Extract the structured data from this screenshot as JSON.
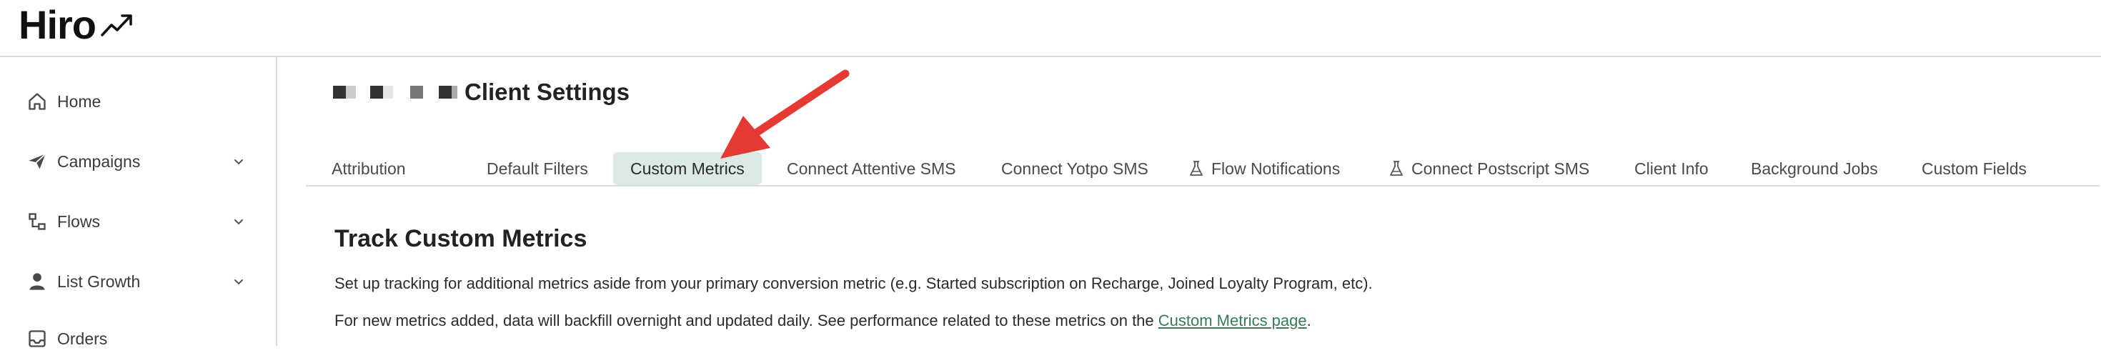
{
  "app": {
    "logo_text": "Hiro",
    "logo_icon": "trending-up-icon"
  },
  "sidebar": {
    "items": [
      {
        "label": "Home",
        "icon": "home-icon",
        "has_chevron": false
      },
      {
        "label": "Campaigns",
        "icon": "paper-plane-icon",
        "has_chevron": true
      },
      {
        "label": "Flows",
        "icon": "flow-icon",
        "has_chevron": true
      },
      {
        "label": "List Growth",
        "icon": "user-icon",
        "has_chevron": true
      },
      {
        "label": "Orders",
        "icon": "orders-icon",
        "has_chevron": false
      }
    ]
  },
  "header": {
    "title": "Client Settings"
  },
  "tabs": [
    {
      "label": "Attribution",
      "active": false,
      "icon": ""
    },
    {
      "label": "Default Filters",
      "active": false,
      "icon": ""
    },
    {
      "label": "Custom Metrics",
      "active": true,
      "icon": ""
    },
    {
      "label": "Connect Attentive SMS",
      "active": false,
      "icon": ""
    },
    {
      "label": "Connect Yotpo SMS",
      "active": false,
      "icon": ""
    },
    {
      "label": "Flow Notifications",
      "active": false,
      "icon": "flask-icon"
    },
    {
      "label": "Connect Postscript SMS",
      "active": false,
      "icon": "flask-icon"
    },
    {
      "label": "Client Info",
      "active": false,
      "icon": ""
    },
    {
      "label": "Background Jobs",
      "active": false,
      "icon": ""
    },
    {
      "label": "Custom Fields",
      "active": false,
      "icon": ""
    }
  ],
  "content": {
    "title": "Track Custom Metrics",
    "para1": "Set up tracking for additional metrics aside from your primary conversion metric (e.g. Started subscription on Recharge, Joined Loyalty Program, etc).",
    "para2_prefix": "For new metrics added, data will backfill overnight and updated daily. See performance related to these metrics on the ",
    "para2_link": "Custom Metrics page",
    "para2_suffix": "."
  },
  "colors": {
    "active_tab_bg": "#dde9e4",
    "link": "#3a7a5a",
    "annotation_arrow": "#e53935"
  }
}
